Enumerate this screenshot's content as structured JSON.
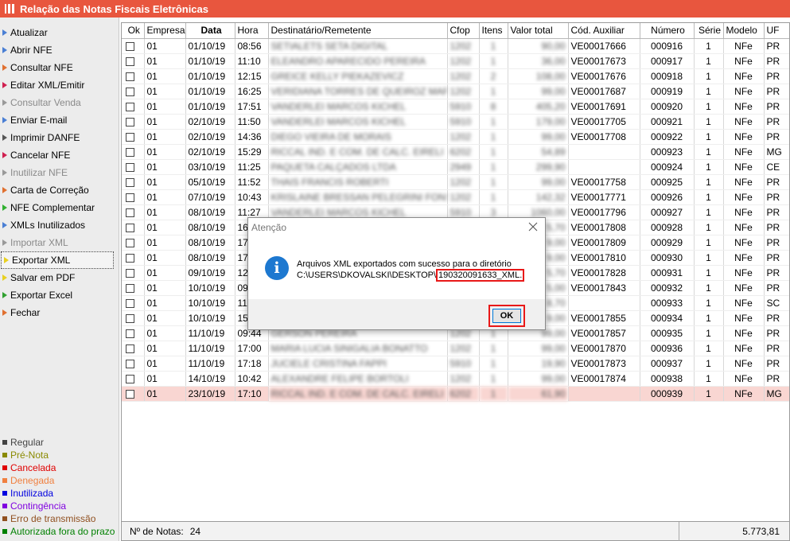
{
  "window": {
    "title": "Relação das Notas Fiscais Eletrônicas"
  },
  "menu": [
    {
      "label": "Atualizar",
      "arrow": "#4a7fd4",
      "enabled": true
    },
    {
      "label": "Abrir NFE",
      "arrow": "#4a7fd4",
      "enabled": true
    },
    {
      "label": "Consultar NFE",
      "arrow": "#e07030",
      "enabled": true
    },
    {
      "label": "Editar XML/Emitir",
      "arrow": "#d02050",
      "enabled": true
    },
    {
      "label": "Consultar Venda",
      "arrow": "#999999",
      "enabled": false
    },
    {
      "label": "Enviar E-mail",
      "arrow": "#4a7fd4",
      "enabled": true
    },
    {
      "label": "Imprimir DANFE",
      "arrow": "#555555",
      "enabled": true
    },
    {
      "label": "Cancelar NFE",
      "arrow": "#d02050",
      "enabled": true
    },
    {
      "label": "Inutilizar NFE",
      "arrow": "#999999",
      "enabled": false
    },
    {
      "label": "Carta de Correção",
      "arrow": "#e07030",
      "enabled": true
    },
    {
      "label": "NFE Complementar",
      "arrow": "#30b030",
      "enabled": true
    },
    {
      "label": "XMLs Inutilizados",
      "arrow": "#4a7fd4",
      "enabled": true
    },
    {
      "label": "Importar XML",
      "arrow": "#999999",
      "enabled": false
    },
    {
      "label": "Exportar XML",
      "arrow": "#e8d020",
      "enabled": true,
      "selected": true
    },
    {
      "label": "Salvar em PDF",
      "arrow": "#e8d020",
      "enabled": true
    },
    {
      "label": "Exportar Excel",
      "arrow": "#30a030",
      "enabled": true
    },
    {
      "label": "Fechar",
      "arrow": "#e07030",
      "enabled": true
    }
  ],
  "legend": [
    {
      "label": "Regular",
      "color": "#444444"
    },
    {
      "label": "Pré-Nota",
      "color": "#8a8a00"
    },
    {
      "label": "Cancelada",
      "color": "#e00000"
    },
    {
      "label": "Denegada",
      "color": "#f08040"
    },
    {
      "label": "Inutilizada",
      "color": "#0000e0"
    },
    {
      "label": "Contingência",
      "color": "#8000e0"
    },
    {
      "label": "Erro de transmissão",
      "color": "#905020"
    },
    {
      "label": "Autorizada fora do prazo",
      "color": "#008000"
    }
  ],
  "columns": [
    "Ok",
    "Empresa",
    "Data",
    "Hora",
    "Destinatário/Remetente",
    "Cfop",
    "Itens",
    "Valor total",
    "Cód. Auxiliar",
    "Número",
    "Série",
    "Modelo",
    "UF"
  ],
  "rows": [
    {
      "empresa": "01",
      "data": "01/10/19",
      "hora": "08:56",
      "dest": "SETIALETS SETA DIGITAL",
      "cfop": "1202",
      "itens": "1",
      "valor": "90,00",
      "aux": "VE00017666",
      "numero": "000916",
      "serie": "1",
      "modelo": "NFe",
      "uf": "PR"
    },
    {
      "empresa": "01",
      "data": "01/10/19",
      "hora": "11:10",
      "dest": "ELEANDRO APARECIDO PEREIRA",
      "cfop": "1202",
      "itens": "1",
      "valor": "36,00",
      "aux": "VE00017673",
      "numero": "000917",
      "serie": "1",
      "modelo": "NFe",
      "uf": "PR"
    },
    {
      "empresa": "01",
      "data": "01/10/19",
      "hora": "12:15",
      "dest": "GREICE KELLY PIEKAZEVICZ",
      "cfop": "1202",
      "itens": "2",
      "valor": "108,00",
      "aux": "VE00017676",
      "numero": "000918",
      "serie": "1",
      "modelo": "NFe",
      "uf": "PR"
    },
    {
      "empresa": "01",
      "data": "01/10/19",
      "hora": "16:25",
      "dest": "VERIDIANA TORRES DE QUEIROZ MARDEI",
      "cfop": "1202",
      "itens": "1",
      "valor": "99,00",
      "aux": "VE00017687",
      "numero": "000919",
      "serie": "1",
      "modelo": "NFe",
      "uf": "PR"
    },
    {
      "empresa": "01",
      "data": "01/10/19",
      "hora": "17:51",
      "dest": "VANDERLEI MARCOS KICHEL",
      "cfop": "5910",
      "itens": "8",
      "valor": "405,20",
      "aux": "VE00017691",
      "numero": "000920",
      "serie": "1",
      "modelo": "NFe",
      "uf": "PR"
    },
    {
      "empresa": "01",
      "data": "02/10/19",
      "hora": "11:50",
      "dest": "VANDERLEI MARCOS KICHEL",
      "cfop": "5910",
      "itens": "1",
      "valor": "179,00",
      "aux": "VE00017705",
      "numero": "000921",
      "serie": "1",
      "modelo": "NFe",
      "uf": "PR"
    },
    {
      "empresa": "01",
      "data": "02/10/19",
      "hora": "14:36",
      "dest": "DIEGO VIEIRA DE MORAIS",
      "cfop": "1202",
      "itens": "1",
      "valor": "99,00",
      "aux": "VE00017708",
      "numero": "000922",
      "serie": "1",
      "modelo": "NFe",
      "uf": "PR"
    },
    {
      "empresa": "01",
      "data": "02/10/19",
      "hora": "15:29",
      "dest": "RICCAL IND. E COM. DE CALC. EIRELI",
      "cfop": "6202",
      "itens": "1",
      "valor": "54,89",
      "aux": "",
      "numero": "000923",
      "serie": "1",
      "modelo": "NFe",
      "uf": "MG"
    },
    {
      "empresa": "01",
      "data": "03/10/19",
      "hora": "11:25",
      "dest": "PAQUETA CALÇADOS LTDA",
      "cfop": "2949",
      "itens": "1",
      "valor": "299,90",
      "aux": "",
      "numero": "000924",
      "serie": "1",
      "modelo": "NFe",
      "uf": "CE"
    },
    {
      "empresa": "01",
      "data": "05/10/19",
      "hora": "11:52",
      "dest": "THAIS FRANCIS ROBERTI",
      "cfop": "1202",
      "itens": "1",
      "valor": "99,00",
      "aux": "VE00017758",
      "numero": "000925",
      "serie": "1",
      "modelo": "NFe",
      "uf": "PR"
    },
    {
      "empresa": "01",
      "data": "07/10/19",
      "hora": "10:43",
      "dest": "KRISLAINE BRESSAN PELEGRINI FONSECA",
      "cfop": "1202",
      "itens": "1",
      "valor": "142,32",
      "aux": "VE00017771",
      "numero": "000926",
      "serie": "1",
      "modelo": "NFe",
      "uf": "PR"
    },
    {
      "empresa": "01",
      "data": "08/10/19",
      "hora": "11:27",
      "dest": "VANDERLEI MARCOS KICHEL",
      "cfop": "5910",
      "itens": "3",
      "valor": "1060,00",
      "aux": "VE00017796",
      "numero": "000927",
      "serie": "1",
      "modelo": "NFe",
      "uf": "PR"
    },
    {
      "empresa": "01",
      "data": "08/10/19",
      "hora": "16",
      "dest": "",
      "cfop": "",
      "itens": "",
      "valor": "5,70",
      "aux": "VE00017808",
      "numero": "000928",
      "serie": "1",
      "modelo": "NFe",
      "uf": "PR"
    },
    {
      "empresa": "01",
      "data": "08/10/19",
      "hora": "17",
      "dest": "",
      "cfop": "",
      "itens": "",
      "valor": "9,00",
      "aux": "VE00017809",
      "numero": "000929",
      "serie": "1",
      "modelo": "NFe",
      "uf": "PR"
    },
    {
      "empresa": "01",
      "data": "08/10/19",
      "hora": "17",
      "dest": "",
      "cfop": "",
      "itens": "",
      "valor": "9,00",
      "aux": "VE00017810",
      "numero": "000930",
      "serie": "1",
      "modelo": "NFe",
      "uf": "PR"
    },
    {
      "empresa": "01",
      "data": "09/10/19",
      "hora": "12",
      "dest": "",
      "cfop": "",
      "itens": "",
      "valor": "5,70",
      "aux": "VE00017828",
      "numero": "000931",
      "serie": "1",
      "modelo": "NFe",
      "uf": "PR"
    },
    {
      "empresa": "01",
      "data": "10/10/19",
      "hora": "09",
      "dest": "",
      "cfop": "",
      "itens": "",
      "valor": "5,00",
      "aux": "VE00017843",
      "numero": "000932",
      "serie": "1",
      "modelo": "NFe",
      "uf": "PR"
    },
    {
      "empresa": "01",
      "data": "10/10/19",
      "hora": "11",
      "dest": "",
      "cfop": "",
      "itens": "",
      "valor": "8,70",
      "aux": "",
      "numero": "000933",
      "serie": "1",
      "modelo": "NFe",
      "uf": "SC"
    },
    {
      "empresa": "01",
      "data": "10/10/19",
      "hora": "15",
      "dest": "",
      "cfop": "",
      "itens": "",
      "valor": "9,00",
      "aux": "VE00017855",
      "numero": "000934",
      "serie": "1",
      "modelo": "NFe",
      "uf": "PR"
    },
    {
      "empresa": "01",
      "data": "11/10/19",
      "hora": "09:44",
      "dest": "GERSON PEREIRA",
      "cfop": "1202",
      "itens": "1",
      "valor": "99,00",
      "aux": "VE00017857",
      "numero": "000935",
      "serie": "1",
      "modelo": "NFe",
      "uf": "PR"
    },
    {
      "empresa": "01",
      "data": "11/10/19",
      "hora": "17:00",
      "dest": "MARIA LUCIA SINIGALIA BONATTO",
      "cfop": "1202",
      "itens": "1",
      "valor": "99,00",
      "aux": "VE00017870",
      "numero": "000936",
      "serie": "1",
      "modelo": "NFe",
      "uf": "PR"
    },
    {
      "empresa": "01",
      "data": "11/10/19",
      "hora": "17:18",
      "dest": "JUCIELE CRISTINA FAPPI",
      "cfop": "5910",
      "itens": "1",
      "valor": "19,90",
      "aux": "VE00017873",
      "numero": "000937",
      "serie": "1",
      "modelo": "NFe",
      "uf": "PR"
    },
    {
      "empresa": "01",
      "data": "14/10/19",
      "hora": "10:42",
      "dest": "ALEXANDRE FELIPE BORTOLI",
      "cfop": "1202",
      "itens": "1",
      "valor": "99,00",
      "aux": "VE00017874",
      "numero": "000938",
      "serie": "1",
      "modelo": "NFe",
      "uf": "PR"
    },
    {
      "empresa": "01",
      "data": "23/10/19",
      "hora": "17:10",
      "dest": "RICCAL IND. E COM. DE CALC. EIRELI",
      "cfop": "6202",
      "itens": "1",
      "valor": "61,90",
      "aux": "",
      "numero": "000939",
      "serie": "1",
      "modelo": "NFe",
      "uf": "MG",
      "highlight": true
    }
  ],
  "footer": {
    "label": "Nº de Notas:",
    "count": "24",
    "total": "5.773,81"
  },
  "dialog": {
    "title": "Atenção",
    "line1": "Arquivos XML exportados com sucesso para o diretório",
    "path_prefix": "C:\\USERS\\DKOVALSKI\\DESKTOP\\",
    "path_highlight": "190320091633_XML.",
    "ok_label": "OK",
    "icon": "info-icon"
  }
}
